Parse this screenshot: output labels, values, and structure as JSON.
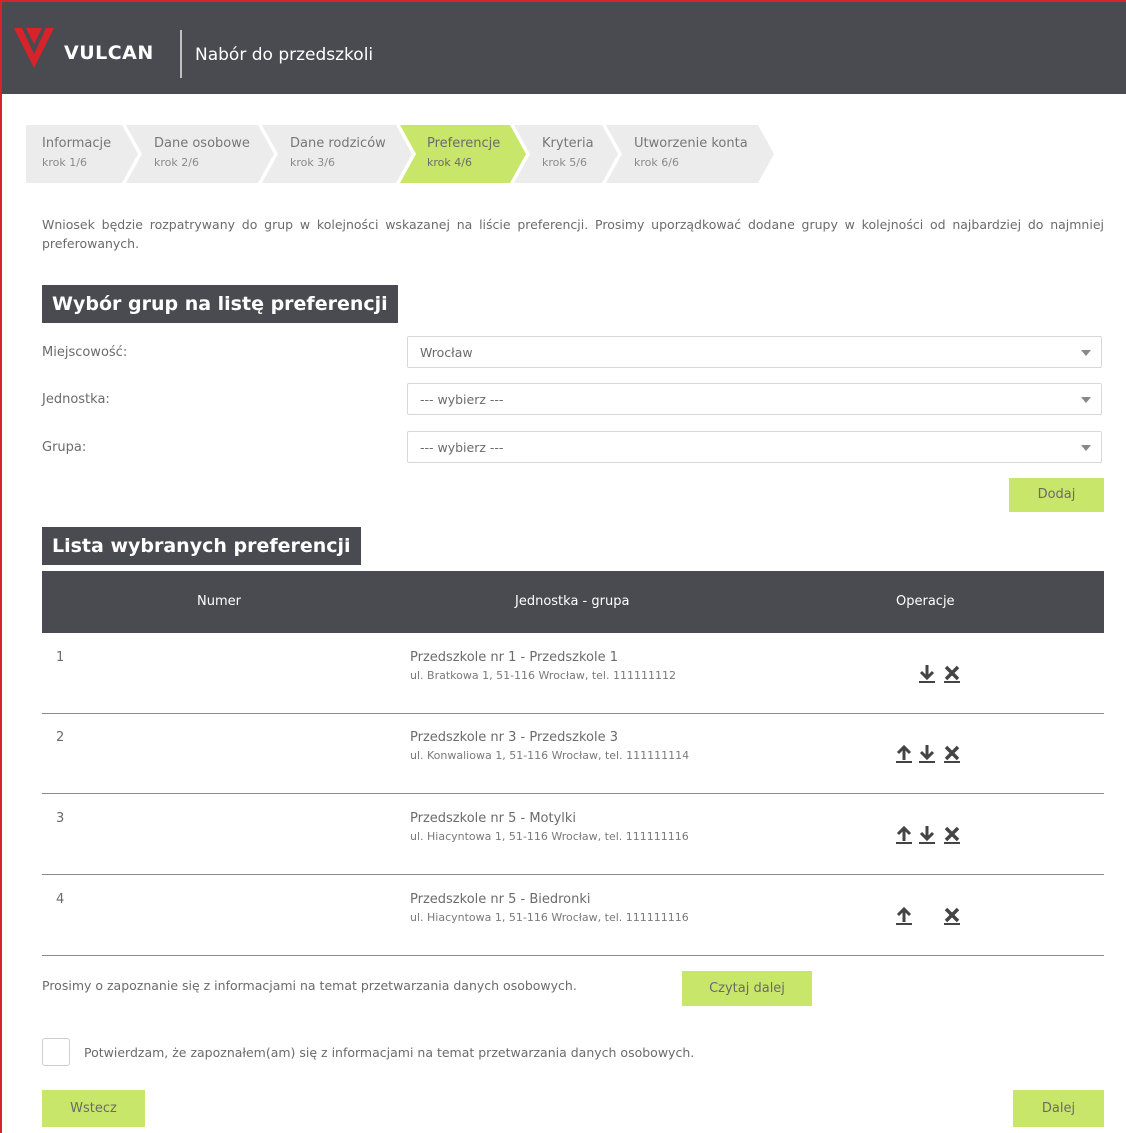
{
  "header": {
    "logo_text": "VULCAN",
    "app_title": "Nabór do przedszkoli"
  },
  "steps": [
    {
      "title": "Informacje",
      "sub": "krok 1/6",
      "active": false
    },
    {
      "title": "Dane osobowe",
      "sub": "krok 2/6",
      "active": false
    },
    {
      "title": "Dane rodziców",
      "sub": "krok 3/6",
      "active": false
    },
    {
      "title": "Preferencje",
      "sub": "krok 4/6",
      "active": true
    },
    {
      "title": "Kryteria",
      "sub": "krok 5/6",
      "active": false
    },
    {
      "title": "Utworzenie konta",
      "sub": "krok 6/6",
      "active": false
    }
  ],
  "intro_text": "Wniosek będzie rozpatrywany do grup w kolejności wskazanej na liście preferencji. Prosimy uporządkować dodane grupy w kolejności od najbardziej do najmniej preferowanych.",
  "selection": {
    "title": "Wybór grup na listę preferencji",
    "city_label": "Miejscowość:",
    "city_value": "Wrocław",
    "unit_label": "Jednostka:",
    "unit_value": "--- wybierz ---",
    "group_label": "Grupa:",
    "group_value": "--- wybierz ---",
    "add_button": "Dodaj"
  },
  "list": {
    "title": "Lista wybranych preferencji",
    "headers": {
      "number": "Numer",
      "unit_group": "Jednostka - grupa",
      "operations": "Operacje"
    },
    "rows": [
      {
        "number": "1",
        "name": "Przedszkole nr 1 - Przedszkole 1",
        "address": "ul. Bratkowa 1, 51-116 Wrocław, tel. 111111112",
        "ops": [
          "move-down",
          "remove"
        ]
      },
      {
        "number": "2",
        "name": "Przedszkole nr 3 - Przedszkole 3",
        "address": "ul. Konwaliowa 1, 51-116 Wrocław, tel. 111111114",
        "ops": [
          "move-up",
          "move-down",
          "remove"
        ]
      },
      {
        "number": "3",
        "name": "Przedszkole nr 5 - Motylki",
        "address": "ul. Hiacyntowa 1, 51-116 Wrocław, tel. 111111116",
        "ops": [
          "move-up",
          "move-down",
          "remove"
        ]
      },
      {
        "number": "4",
        "name": "Przedszkole nr 5 - Biedronki",
        "address": "ul. Hiacyntowa 1, 51-116 Wrocław, tel. 111111116",
        "ops": [
          "move-up",
          "remove"
        ]
      }
    ]
  },
  "privacy": {
    "info_text": "Prosimy o zapoznanie się z informacjami na temat przetwarzania danych osobowych.",
    "read_more_button": "Czytaj dalej",
    "confirm_text": "Potwierdzam, że zapoznałem(am) się z informacjami na temat przetwarzania danych osobowych."
  },
  "nav": {
    "back_button": "Wstecz",
    "next_button": "Dalej"
  },
  "colors": {
    "header_bg": "#4a4a51",
    "accent": "#c7e66a",
    "brand_red": "#d9232a"
  }
}
